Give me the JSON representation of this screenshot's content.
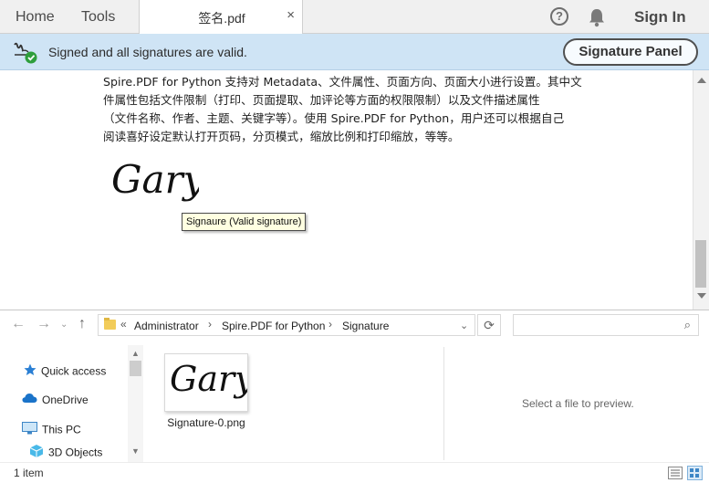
{
  "acrobat": {
    "nav": {
      "home": "Home",
      "tools": "Tools"
    },
    "document_tab": {
      "title": "签名.pdf",
      "close": "×"
    },
    "help_glyph": "?",
    "sign_in": "Sign In"
  },
  "signature_bar": {
    "status_text": "Signed and all signatures are valid.",
    "panel_button": "Signature Panel",
    "valid_color": "#2e9e3c"
  },
  "document": {
    "paragraph_lines": [
      "Spire.PDF for Python 支持对 Metadata、文件属性、页面方向、页面大小进行设置。其中文",
      "件属性包括文件限制（打印、页面提取、加评论等方面的权限限制）以及文件描述属性",
      "（文件名称、作者、主题、关键字等）。使用 Spire.PDF for Python，用户还可以根据自己",
      "阅读喜好设定默认打开页码，分页模式，缩放比例和打印缩放，等等。"
    ],
    "signature_script": "Gary",
    "tooltip": "Signaure (Valid signature)"
  },
  "explorer": {
    "address": {
      "overflow": "«",
      "crumbs": [
        "Administrator",
        "Spire.PDF for Python",
        "Signature"
      ],
      "separator": "›"
    },
    "nav_items": [
      {
        "label": "Quick access",
        "icon": "star-icon"
      },
      {
        "label": "OneDrive",
        "icon": "cloud-icon"
      },
      {
        "label": "This PC",
        "icon": "monitor-icon"
      },
      {
        "label": "3D Objects",
        "icon": "cube-icon"
      }
    ],
    "file": {
      "name": "Signature-0.png",
      "thumbnail_text": "Gary"
    },
    "preview_text": "Select a file to preview.",
    "item_count": "1 item"
  }
}
